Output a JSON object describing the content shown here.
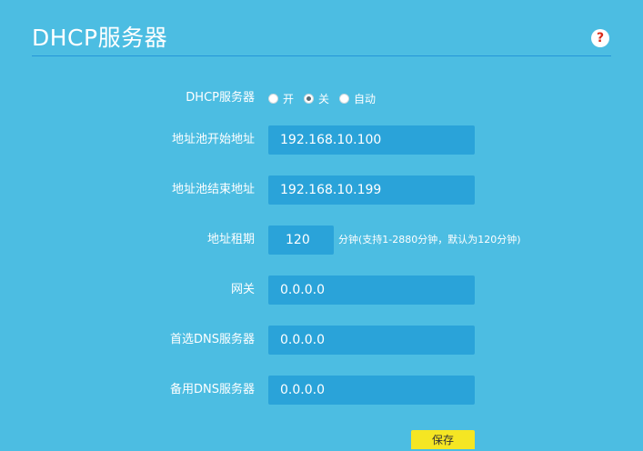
{
  "header": {
    "title": "DHCP服务器",
    "help_icon": "?"
  },
  "dhcp_server": {
    "label": "DHCP服务器",
    "options": [
      {
        "label": "开",
        "checked": false
      },
      {
        "label": "关",
        "checked": true
      },
      {
        "label": "自动",
        "checked": false
      }
    ]
  },
  "pool_start": {
    "label": "地址池开始地址",
    "value": "192.168.10.100"
  },
  "pool_end": {
    "label": "地址池结束地址",
    "value": "192.168.10.199"
  },
  "lease": {
    "label": "地址租期",
    "value": "120",
    "hint": "分钟(支持1-2880分钟，默认为120分钟)"
  },
  "gateway": {
    "label": "网关",
    "value": "0.0.0.0"
  },
  "dns_primary": {
    "label": "首选DNS服务器",
    "value": "0.0.0.0"
  },
  "dns_secondary": {
    "label": "备用DNS服务器",
    "value": "0.0.0.0"
  },
  "actions": {
    "save_label": "保存"
  },
  "colors": {
    "background": "#4cbde2",
    "field": "#2aa3d9",
    "save": "#f5e623",
    "help": "#d92b1a"
  }
}
